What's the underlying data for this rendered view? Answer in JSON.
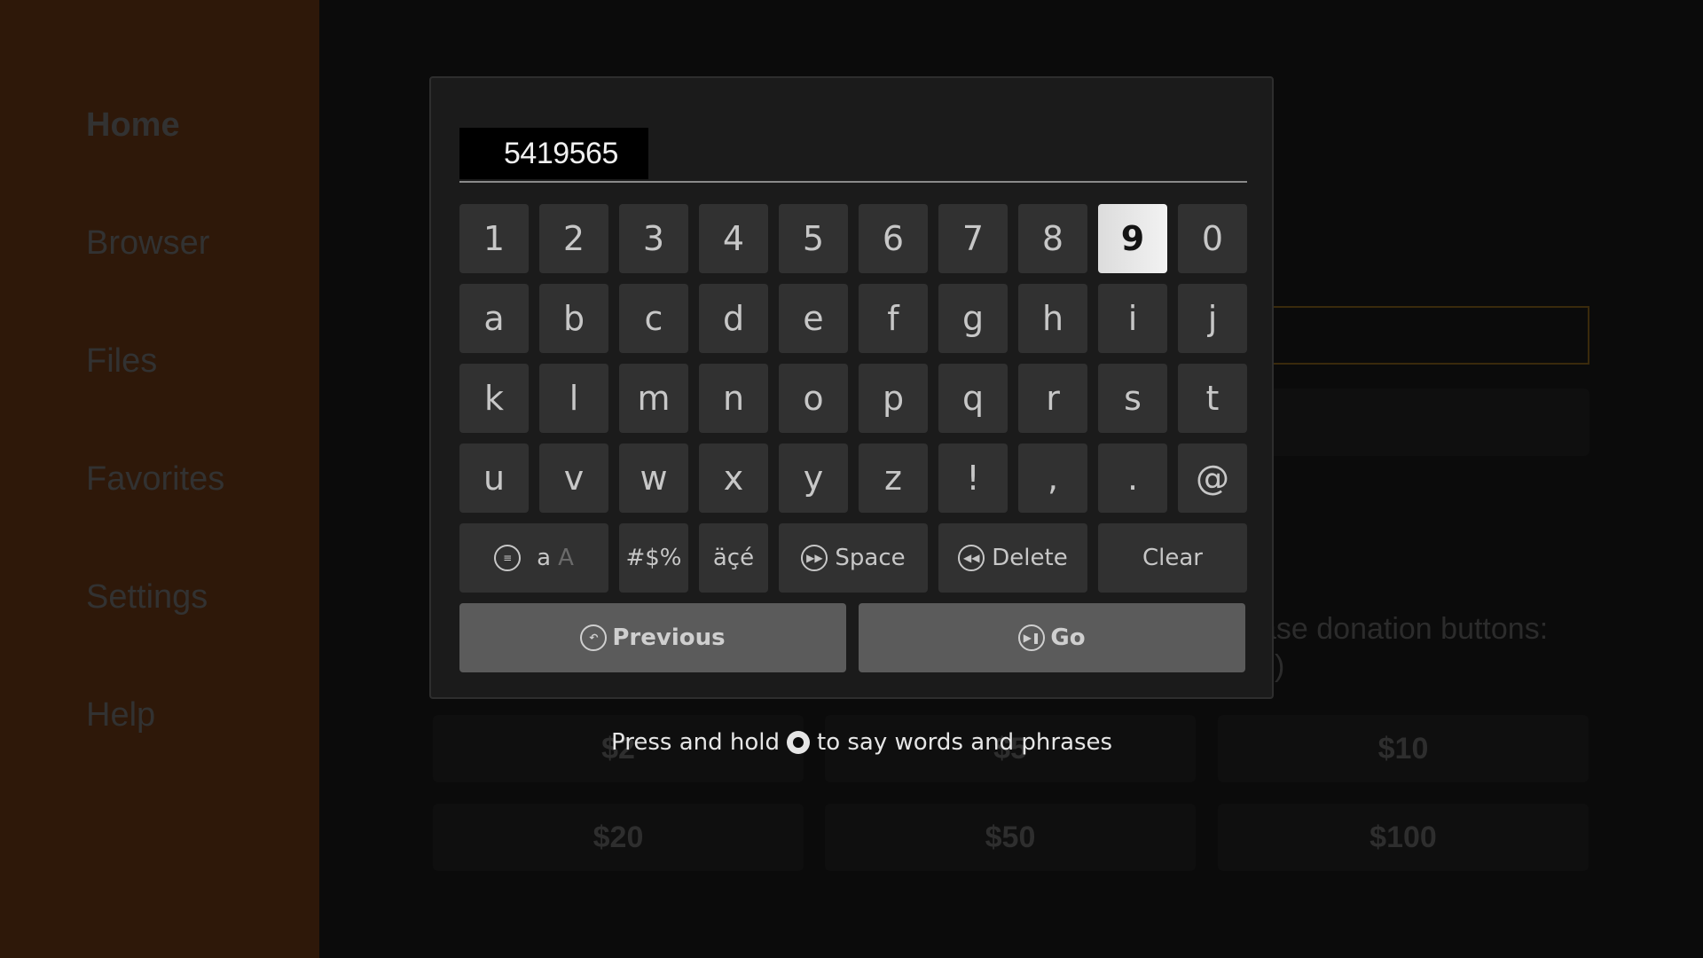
{
  "sidebar": {
    "items": [
      {
        "label": "Home",
        "active": true
      },
      {
        "label": "Browser",
        "active": false
      },
      {
        "label": "Files",
        "active": false
      },
      {
        "label": "Favorites",
        "active": false
      },
      {
        "label": "Settings",
        "active": false
      },
      {
        "label": "Help",
        "active": false
      }
    ]
  },
  "background": {
    "donation_prompt_line1": "ase donation buttons:",
    "donation_prompt_line2": "s)",
    "donation_buttons": [
      "$2",
      "$5",
      "$10",
      "$20",
      "$50",
      "$100"
    ],
    "focus_color": "#3a2a0c"
  },
  "keyboard": {
    "input_value": "5419565",
    "focused_key": "9",
    "rows": [
      [
        "1",
        "2",
        "3",
        "4",
        "5",
        "6",
        "7",
        "8",
        "9",
        "0"
      ],
      [
        "a",
        "b",
        "c",
        "d",
        "e",
        "f",
        "g",
        "h",
        "i",
        "j"
      ],
      [
        "k",
        "l",
        "m",
        "n",
        "o",
        "p",
        "q",
        "r",
        "s",
        "t"
      ],
      [
        "u",
        "v",
        "w",
        "x",
        "y",
        "z",
        "!",
        ",",
        ".",
        "@"
      ]
    ],
    "function_keys": {
      "case_lower": "a",
      "case_upper": "A",
      "symbols": "#$%",
      "accents": "äçé",
      "space": "Space",
      "delete": "Delete",
      "clear": "Clear"
    },
    "previous_label": "Previous",
    "go_label": "Go",
    "hint_before": "Press and hold",
    "hint_after": "to say words and phrases"
  }
}
